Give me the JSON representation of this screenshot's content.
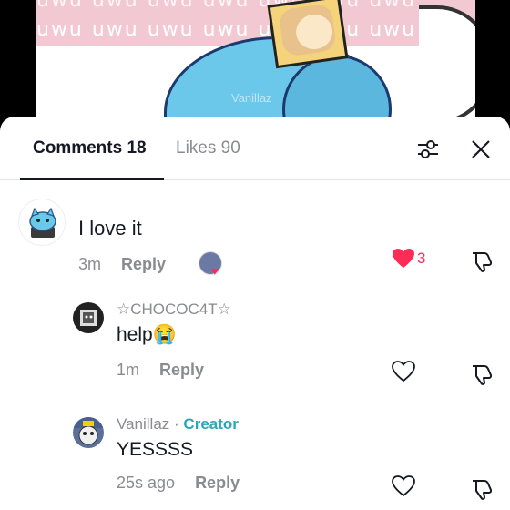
{
  "video": {
    "uwu_text": "uwu uwu uwu uwu uwu uwu uwu",
    "watermark": "Vanillaz"
  },
  "tabs": {
    "comments_label": "Comments 18",
    "likes_label": "Likes 90"
  },
  "comments": [
    {
      "username": "",
      "text": "I love it",
      "time": "3m",
      "reply_label": "Reply",
      "likes": "3",
      "liked": true
    },
    {
      "username": "☆CHOCOC4T☆",
      "text": "help😭",
      "time": "1m",
      "reply_label": "Reply",
      "liked": false
    },
    {
      "username": "Vanillaz",
      "badge": "Creator",
      "separator": "·",
      "text": "YESSSS",
      "time": "25s ago",
      "reply_label": "Reply",
      "liked": false
    }
  ],
  "colors": {
    "like_red": "#fe2c55",
    "creator_teal": "#2aa8b8",
    "text_primary": "#161823",
    "text_secondary": "#8a8b91"
  },
  "icons": [
    "filter-icon",
    "close-icon",
    "heart-icon",
    "thumbs-down-icon"
  ]
}
